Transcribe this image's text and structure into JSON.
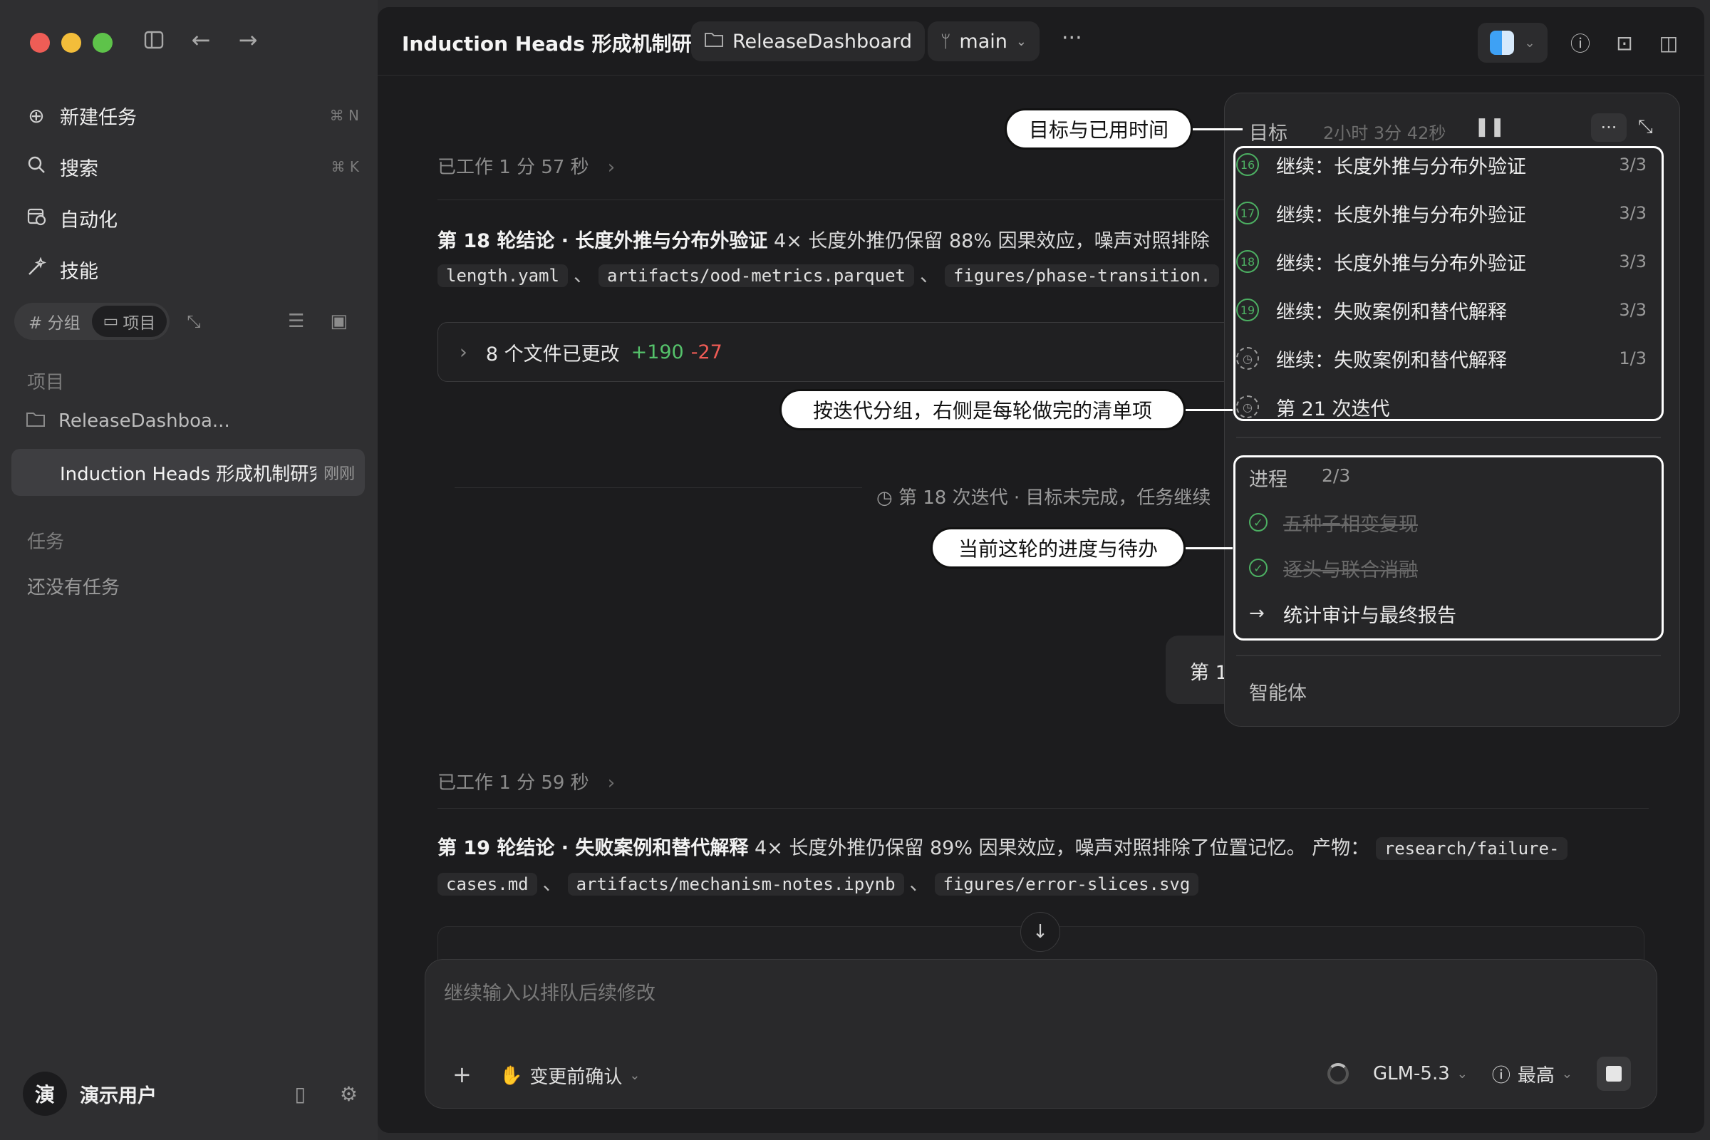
{
  "sidebar": {
    "nav": [
      {
        "label": "新建任务",
        "kbd": "⌘ N",
        "icon": "plus-circle-icon"
      },
      {
        "label": "搜索",
        "kbd": "⌘ K",
        "icon": "search-icon"
      },
      {
        "label": "自动化",
        "kbd": "",
        "icon": "calendar-clock-icon"
      },
      {
        "label": "技能",
        "kbd": "",
        "icon": "wand-icon"
      }
    ],
    "seg_group": "# 分组",
    "seg_project": "项目",
    "section_projects": "项目",
    "project_1": "ReleaseDashboa...",
    "project_active": "Induction Heads 形成机制研究",
    "project_active_time": "刚刚",
    "section_tasks": "任务",
    "no_tasks": "还没有任务",
    "user_avatar": "演",
    "user_name": "演示用户"
  },
  "topbar": {
    "title": "Induction Heads 形成机制研究",
    "folder_chip": "ReleaseDashboard",
    "branch_chip": "main",
    "more": "···"
  },
  "content": {
    "worked_1": "已工作 1 分 57 秒",
    "round18_title": "第 18 轮结论 · 长度外推与分布外验证",
    "round18_text": " 4× 长度外推仍保留 88% 因果效应，噪声对照排除",
    "round18_files": [
      "length.yaml",
      "artifacts/ood-metrics.parquet",
      "figures/phase-transition."
    ],
    "files_changed": "8 个文件已更改",
    "files_add": "+190",
    "files_del": "-27",
    "iteration_note": "第 18 次迭代 · 目标未完成，任务继续",
    "bubble_text": "第 1",
    "worked_2": "已工作 1 分 59 秒",
    "round19_title": "第 19 轮结论 · 失败案例和替代解释",
    "round19_text": " 4× 长度外推仍保留 89% 因果效应，噪声对照排除了位置记忆。 产物：",
    "round19_file_a": "research/failure-",
    "round19_file_b": "cases.md",
    "round19_files": [
      "artifacts/mechanism-notes.ipynb",
      "figures/error-slices.svg"
    ]
  },
  "composer": {
    "placeholder": "继续输入以排队后续修改",
    "confirm_label": "变更前确认",
    "model": "GLM-5.3",
    "level": "最高"
  },
  "panel": {
    "goal_label": "目标",
    "elapsed": "2小时 3分 42秒",
    "iterations": [
      {
        "num": "16",
        "label": "继续：长度外推与分布外验证",
        "count": "3/3",
        "done": true
      },
      {
        "num": "17",
        "label": "继续：长度外推与分布外验证",
        "count": "3/3",
        "done": true
      },
      {
        "num": "18",
        "label": "继续：长度外推与分布外验证",
        "count": "3/3",
        "done": true
      },
      {
        "num": "19",
        "label": "继续：失败案例和替代解释",
        "count": "3/3",
        "done": true
      },
      {
        "num": "",
        "label": "继续：失败案例和替代解释",
        "count": "1/3",
        "done": false
      },
      {
        "num": "",
        "label": "第 21 次迭代",
        "count": "",
        "done": false
      }
    ],
    "progress_label": "进程",
    "progress_count": "2/3",
    "progress_items": [
      {
        "label": "五种子相变复现",
        "done": true
      },
      {
        "label": "逐头与联合消融",
        "done": true
      },
      {
        "label": "统计审计与最终报告",
        "done": false
      }
    ],
    "agent_label": "智能体"
  },
  "callouts": {
    "goal_time": "目标与已用时间",
    "iter_group": "按迭代分组，右侧是每轮做完的清单项",
    "progress": "当前这轮的进度与待办"
  },
  "colors": {
    "accent_green": "#4caf62",
    "add_green": "#55c26b",
    "del_red": "#ee5b55"
  }
}
